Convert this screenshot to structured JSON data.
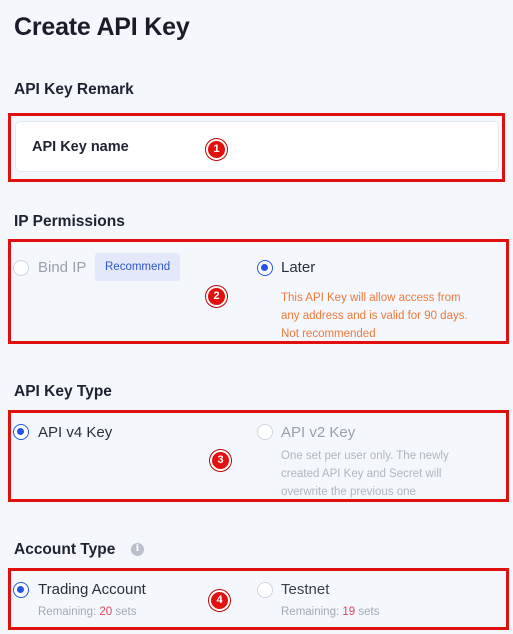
{
  "page": {
    "title": "Create API Key"
  },
  "remark": {
    "section_title": "API Key Remark",
    "input_label": "API Key name",
    "badge": "1"
  },
  "ip_permissions": {
    "section_title": "IP Permissions",
    "badge": "2",
    "options": [
      {
        "label": "Bind IP",
        "selected": false,
        "tag": "Recommend"
      },
      {
        "label": "Later",
        "selected": true,
        "note_lines": [
          "This API Key will allow access from",
          "any address and is valid for 90 days.",
          "Not recommended"
        ]
      }
    ]
  },
  "key_type": {
    "section_title": "API Key Type",
    "badge": "3",
    "options": [
      {
        "label": "API v4 Key",
        "selected": true
      },
      {
        "label": "API v2 Key",
        "selected": false,
        "note_lines": [
          "One set per user only. The newly",
          "created API Key and Secret will",
          "overwrite the previous one"
        ]
      }
    ]
  },
  "account_type": {
    "section_title": "Account Type",
    "info_icon": "info-icon",
    "badge": "4",
    "options": [
      {
        "label": "Trading Account",
        "selected": true,
        "remaining_prefix": "Remaining: ",
        "remaining_count": "20",
        "remaining_suffix": " sets"
      },
      {
        "label": "Testnet",
        "selected": false,
        "remaining_prefix": "Remaining: ",
        "remaining_count": "19",
        "remaining_suffix": " sets"
      }
    ]
  },
  "colors": {
    "accent": "#2354e6",
    "annotation_red": "#e01010",
    "warning_orange": "#ec7a3c",
    "count_red": "#e0475b",
    "background": "#f4f7fc"
  }
}
